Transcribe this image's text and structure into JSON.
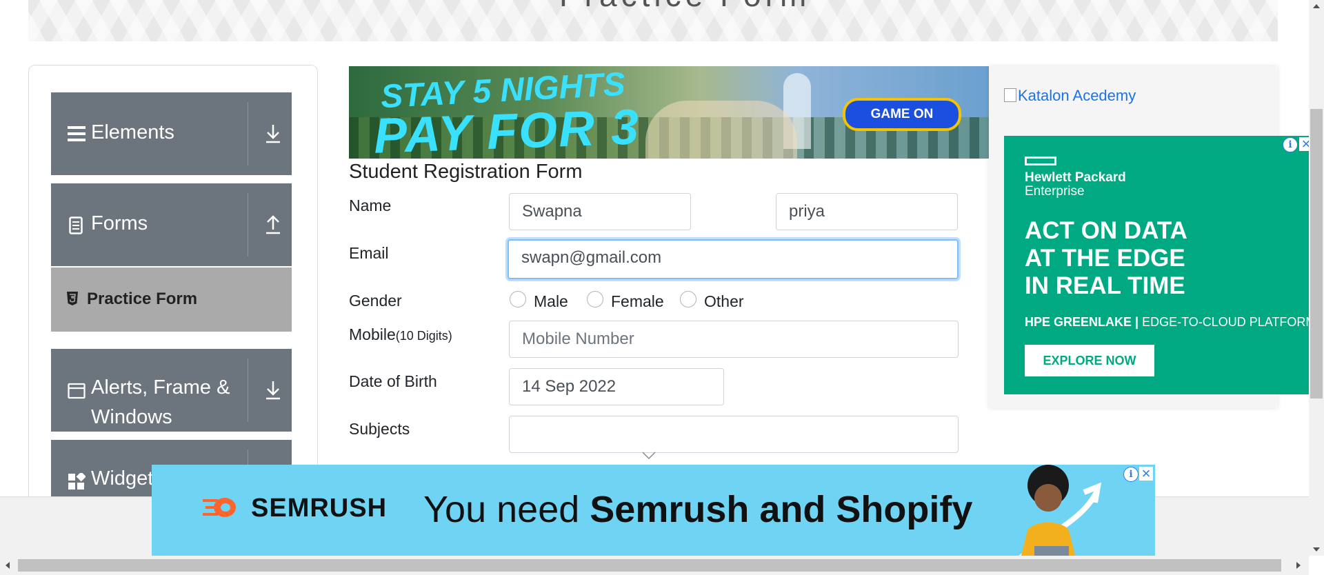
{
  "page": {
    "heading": "Practice Form"
  },
  "sidebar": {
    "groups": [
      {
        "label": "Elements",
        "icon": "hamburger-icon",
        "arrow": "download-arrow-icon"
      },
      {
        "label": "Forms",
        "icon": "document-icon",
        "arrow": "upload-arrow-icon"
      },
      {
        "label": "Alerts, Frame &",
        "label_line2": "Windows",
        "icon": "window-icon",
        "arrow": "download-arrow-icon"
      },
      {
        "label": "Widgets",
        "icon": "widgets-icon"
      }
    ],
    "active_item": {
      "label": "Practice Form",
      "icon": "html5-icon"
    }
  },
  "top_ad": {
    "line1": "STAY 5 NIGHTS",
    "line2": "PAY FOR 3",
    "cta": "GAME ON"
  },
  "form": {
    "title": "Student Registration Form",
    "name": {
      "label": "Name",
      "first_value": "Swapna",
      "last_value": "priya"
    },
    "email": {
      "label": "Email",
      "value": "swapn@gmail.com"
    },
    "gender": {
      "label": "Gender",
      "options": [
        "Male",
        "Female",
        "Other"
      ]
    },
    "mobile": {
      "label": "Mobile",
      "label_hint": "(10 Digits)",
      "placeholder": "Mobile Number",
      "value": ""
    },
    "dob": {
      "label": "Date of Birth",
      "value": "14 Sep 2022"
    },
    "subjects": {
      "label": "Subjects",
      "value": ""
    }
  },
  "right_ad": {
    "image_alt": "Katalon Acedemy",
    "brand_line1": "Hewlett Packard",
    "brand_line2": "Enterprise",
    "headline_lines": [
      "ACT ON DATA",
      "AT THE EDGE",
      "IN REAL TIME"
    ],
    "subline_bold": "HPE GREENLAKE |",
    "subline": " EDGE-TO-CLOUD PLATFORM",
    "cta": "EXPLORE NOW"
  },
  "bottom_ad": {
    "brand": "SEMRUSH",
    "message_plain": "You need ",
    "message_bold": "Semrush and Shopify"
  },
  "colors": {
    "sidebar_group": "#6c757d",
    "sidebar_active": "#aaaaaa",
    "hpe_green": "#01a982",
    "semrush_bg": "#6fd3f4",
    "link_blue": "#1a73e8",
    "focus_border": "#80bdff"
  }
}
